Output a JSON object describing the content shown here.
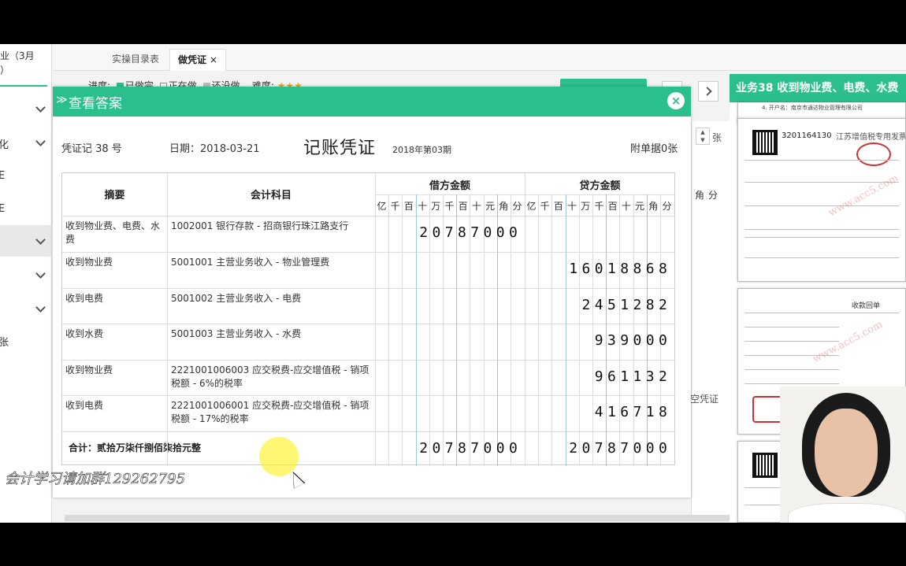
{
  "sidebar": {
    "title_line1": "业（3月",
    "title_line2": "）",
    "items": [
      {
        "label": ""
      },
      {
        "label": "化"
      },
      {
        "label": "E"
      },
      {
        "label": "E"
      },
      {
        "label": ""
      },
      {
        "label": ""
      },
      {
        "label": ""
      },
      {
        "label": "张"
      }
    ]
  },
  "tabs": {
    "items": [
      {
        "label": "实操目录表"
      },
      {
        "label": "做凭证",
        "close": "×"
      }
    ]
  },
  "filter_bar": {
    "progress_label": "进度:",
    "done": "已做完",
    "doing": "正在做",
    "todo": "还没做",
    "difficulty_label": "难度:"
  },
  "modal": {
    "title": "查看答案",
    "close": "×",
    "voucher": {
      "number": "凭证记 38 号",
      "date": "日期：2018-03-21",
      "title": "记账凭证",
      "period": "2018年第03期",
      "attachments": "附单据0张",
      "headers": {
        "summary": "摘要",
        "account": "会计科目",
        "debit": "借方金额",
        "credit": "贷方金额",
        "digits": [
          "亿",
          "千",
          "百",
          "十",
          "万",
          "千",
          "百",
          "十",
          "元",
          "角",
          "分"
        ]
      },
      "rows": [
        {
          "summary": "收到物业费、电费、水费",
          "account": "1002001 银行存款 - 招商银行珠江路支行",
          "debit": "20787000",
          "credit": ""
        },
        {
          "summary": "收到物业费",
          "account": "5001001 主营业务收入 - 物业管理费",
          "debit": "",
          "credit": "1601886 8"
        },
        {
          "summary": "收到电费",
          "account": "5001002 主营业务收入 - 电费",
          "debit": "",
          "credit": "2451282"
        },
        {
          "summary": "收到水费",
          "account": "5001003 主营业务收入 - 水费",
          "debit": "",
          "credit": "939000"
        },
        {
          "summary": "收到物业费",
          "account": "2221001006003 应交税费-应交增值税 - 销项税额 - 6%的税率",
          "debit": "",
          "credit": "961132"
        },
        {
          "summary": "收到电费",
          "account": "2221001006001 应交税费-应交增值税 - 销项税额 - 17%的税率",
          "debit": "",
          "credit": "416718"
        }
      ],
      "total": {
        "label": "合计：贰拾万柒仟捌佰柒拾元整",
        "debit": "20787000",
        "credit": "20787000"
      }
    }
  },
  "right_panel": {
    "title": "业务38 收到物业费、电费、水费",
    "doc1_top": "4. 开户名：南京市通达物业管理有限公司",
    "doc1_code": "3201164130",
    "doc1_type": "江苏增值税专用发票",
    "doc2_title": "收款回单",
    "watermark": "www.acc5.com"
  },
  "background": {
    "zhang": "张",
    "jiao": "角",
    "fen": "分",
    "kong": "空凭证"
  },
  "overlay": {
    "group_text": "会计学习请加群129262795"
  },
  "colors": {
    "accent": "#2bbf8e",
    "blue_rule": "#9cc8e6",
    "red_rule": "#e8a7a7"
  }
}
